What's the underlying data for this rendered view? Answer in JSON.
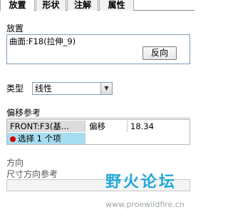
{
  "tabs": [
    {
      "label": "放置",
      "active": true
    },
    {
      "label": "形状",
      "active": false
    },
    {
      "label": "注解",
      "active": false
    },
    {
      "label": "属性",
      "active": false
    }
  ],
  "placement": {
    "section_label": "放置",
    "surface_value": "曲面:F18(拉伸_9)",
    "flip_button": "反向"
  },
  "type": {
    "label": "类型",
    "selected": "线性"
  },
  "offset_refs": {
    "label": "偏移参考",
    "rows": [
      {
        "ref": "FRONT:F3(基...",
        "name": "偏移",
        "value": "18.34"
      }
    ],
    "select_prompt": "选择 1 个项"
  },
  "direction": {
    "label": "方向"
  },
  "dimension_direction": {
    "label": "尺寸方向参考"
  },
  "watermark": {
    "text": "野火论坛",
    "url": "www.proewildfire.cn"
  },
  "colors": {
    "selection_highlight": "#a6ddf0",
    "status_dot": "#d40000",
    "watermark": "#23a8d8"
  }
}
